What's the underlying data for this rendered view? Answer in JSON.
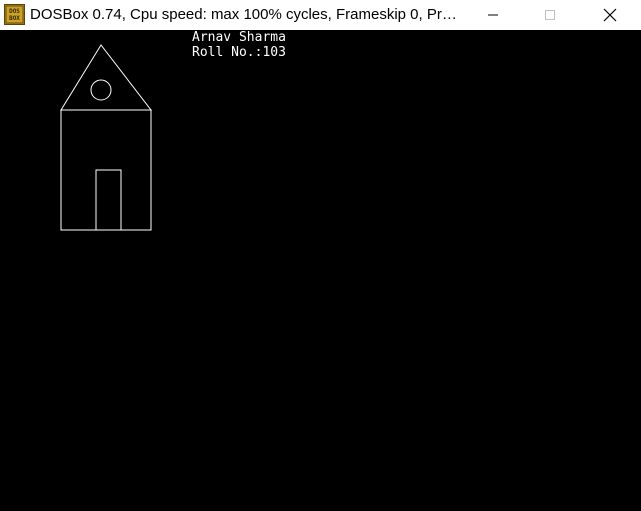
{
  "window": {
    "title": "DOSBox 0.74, Cpu speed: max 100% cycles, Frameskip  0, Progra...",
    "app_icon": "dosbox-icon",
    "app_icon_text": "DOS BOX",
    "controls": {
      "minimize_icon": "minimize-icon",
      "maximize_icon": "maximize-icon",
      "close_icon": "close-icon"
    }
  },
  "screen": {
    "background": "#000000",
    "foreground": "#ffffff",
    "text_lines": {
      "name": "Arnav Sharma",
      "roll": "Roll No.:103"
    },
    "drawing": "house-outline"
  }
}
